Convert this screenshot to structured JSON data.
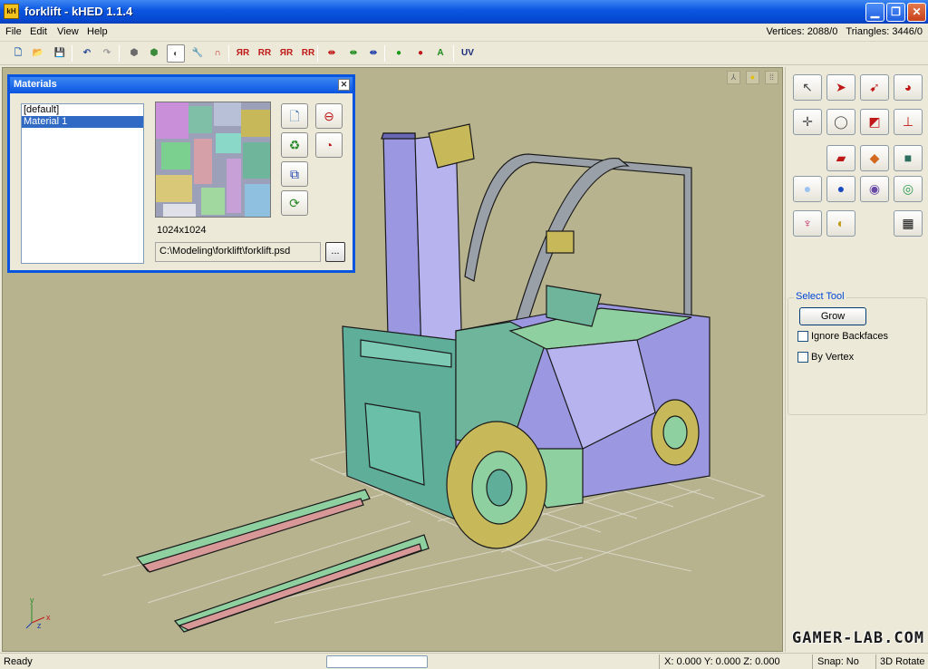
{
  "window": {
    "title": "forklift - kHED 1.1.4",
    "app_icon_text": "kH",
    "minimize": "▁",
    "maximize": "❐",
    "close": "✕"
  },
  "menu": {
    "items": [
      "File",
      "Edit",
      "View",
      "Help"
    ],
    "vertices": "Vertices: 2088/0",
    "triangles": "Triangles: 3446/0"
  },
  "toolbar": {
    "buttons": [
      {
        "icon": "new-file-icon",
        "glyph": "🗋",
        "color": "#3a6fb0"
      },
      {
        "icon": "open-folder-icon",
        "glyph": "📂",
        "color": "#c59a1e"
      },
      {
        "icon": "save-icon",
        "glyph": "💾",
        "color": "#5a6ea8"
      },
      {
        "icon": "undo-icon",
        "glyph": "↶",
        "color": "#2b4c9a"
      },
      {
        "icon": "redo-icon",
        "glyph": "↷",
        "color": "#9a9a9a"
      },
      {
        "icon": "import-icon",
        "glyph": "⬢",
        "color": "#6b6b6b"
      },
      {
        "icon": "export-icon",
        "glyph": "⬢",
        "color": "#3c8a3c"
      },
      {
        "icon": "materials-icon",
        "glyph": "◐",
        "color": "#555555"
      },
      {
        "icon": "wrench-icon",
        "glyph": "🔧",
        "color": "#2a8a2a"
      },
      {
        "icon": "magnet-icon",
        "glyph": "∩",
        "color": "#c02020"
      },
      {
        "icon": "mirror-x-icon",
        "glyph": "ЯR",
        "color": "#c01818"
      },
      {
        "icon": "mirror-y-icon",
        "glyph": "RR",
        "color": "#c01818"
      },
      {
        "icon": "mirror-z-icon",
        "glyph": "ЯR",
        "color": "#c01818"
      },
      {
        "icon": "flip-icon",
        "glyph": "RR",
        "color": "#c01818"
      },
      {
        "icon": "split-x-icon",
        "glyph": "⇹",
        "color": "#c01818"
      },
      {
        "icon": "split-y-icon",
        "glyph": "⇹",
        "color": "#1a8a1a"
      },
      {
        "icon": "split-z-icon",
        "glyph": "⇹",
        "color": "#1a3aa8"
      },
      {
        "icon": "group-icon",
        "glyph": "●",
        "color": "#1a9a1a"
      },
      {
        "icon": "ungroup-icon",
        "glyph": "●",
        "color": "#c01818"
      },
      {
        "icon": "select-all-icon",
        "glyph": "A",
        "color": "#1a8a1a"
      },
      {
        "icon": "uv-icon",
        "glyph": "UV",
        "color": "#1a2a7a"
      }
    ]
  },
  "materials": {
    "title": "Materials",
    "list": [
      "[default]",
      "Material 1"
    ],
    "selected_index": 1,
    "texture_size": "1024x1024",
    "texture_path": "C:\\Modeling\\forklift\\forklift.psd",
    "browse_label": "...",
    "buttons": [
      {
        "icon": "new-material-icon",
        "glyph": "🗋",
        "color": "#3a6fb0"
      },
      {
        "icon": "delete-material-icon",
        "glyph": "⊖",
        "color": "#c01818"
      },
      {
        "icon": "recycle-texture-icon",
        "glyph": "♻",
        "color": "#2a8a2a"
      },
      {
        "icon": "clear-texture-icon",
        "glyph": "◔",
        "color": "#c01818"
      },
      {
        "icon": "copy-material-icon",
        "glyph": "⧉",
        "color": "#1a3aa8"
      },
      {
        "icon": "reload-texture-icon",
        "glyph": "⟳",
        "color": "#2a8a2a"
      }
    ]
  },
  "viewport": {
    "corner_icons": [
      "perspective-icon",
      "light-icon",
      "grid-icon"
    ],
    "corner_glyphs": [
      "⅄",
      "●",
      "⁞⁞"
    ],
    "background_color": "#b7b38f",
    "axes": {
      "x": "x",
      "y": "y",
      "z": "z"
    }
  },
  "tools": [
    {
      "icon": "select-pointer-icon",
      "glyph": "↖",
      "color": "#444444"
    },
    {
      "icon": "select-arrow-icon",
      "glyph": "➤",
      "color": "#c01818"
    },
    {
      "icon": "select-lasso-icon",
      "glyph": "➹",
      "color": "#c01818"
    },
    {
      "icon": "paint-select-icon",
      "glyph": "◕",
      "color": "#c01818"
    },
    {
      "icon": "move-icon",
      "glyph": "✛",
      "color": "#555555"
    },
    {
      "icon": "rotate-icon",
      "glyph": "◯",
      "color": "#555555"
    },
    {
      "icon": "scale-icon",
      "glyph": "◩",
      "color": "#c01818"
    },
    {
      "icon": "pivot-icon",
      "glyph": "⊥",
      "color": "#c01818"
    },
    {
      "icon": "create-plane-icon",
      "glyph": "▰",
      "color": "#c01818"
    },
    {
      "icon": "create-box-flat-icon",
      "glyph": "◆",
      "color": "#d2691e"
    },
    {
      "icon": "create-box-icon",
      "glyph": "■",
      "color": "#2f6f5f"
    },
    {
      "icon": "create-sphere-icon",
      "glyph": "●",
      "color": "#9dc3f0"
    },
    {
      "icon": "create-geosphere-icon",
      "glyph": "●",
      "color": "#1a4abf"
    },
    {
      "icon": "create-torus-icon",
      "glyph": "◉",
      "color": "#6a4aa8"
    },
    {
      "icon": "create-ring-icon",
      "glyph": "◎",
      "color": "#2a9a4a"
    },
    {
      "icon": "create-cylinder-icon",
      "glyph": "♆",
      "color": "#c02a5a"
    },
    {
      "icon": "create-cone-icon",
      "glyph": "◐",
      "color": "#c09a1a"
    },
    {
      "icon": "checker-icon",
      "glyph": "▦",
      "color": "#111111"
    }
  ],
  "select_tool": {
    "title": "Select Tool",
    "grow_label": "Grow",
    "ignore_backfaces": "Ignore Backfaces",
    "by_vertex": "By Vertex"
  },
  "status": {
    "ready": "Ready",
    "coords": "X: 0.000 Y: 0.000 Z: 0.000",
    "snap": "Snap: No",
    "mode": "3D Rotate"
  },
  "watermark": "GAMER-LAB.COM"
}
